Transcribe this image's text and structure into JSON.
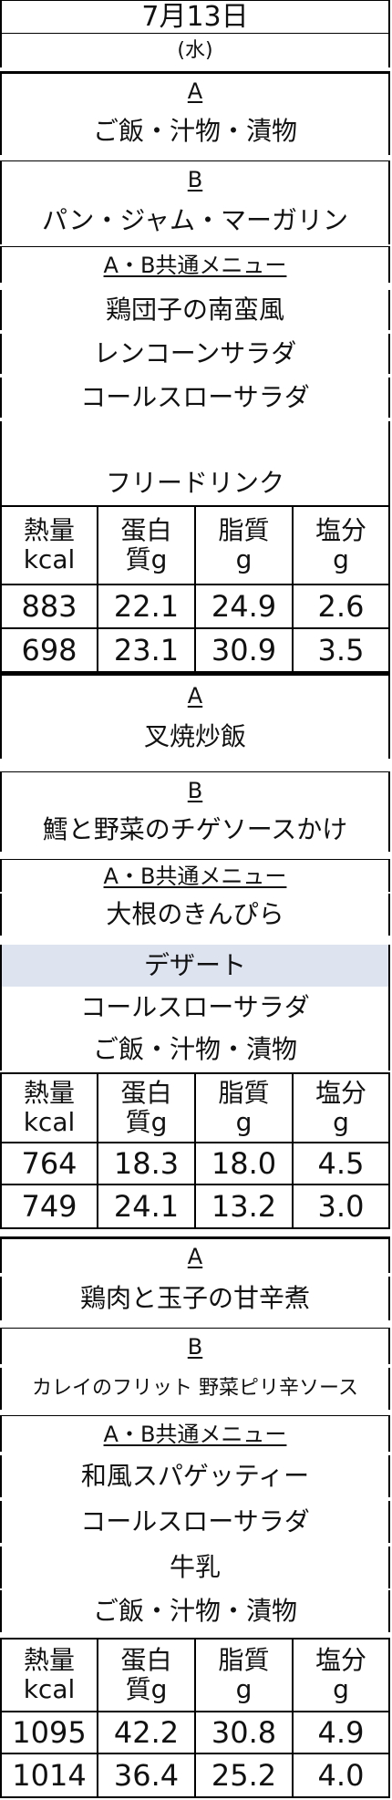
{
  "header": {
    "date": "7月13日",
    "weekday": "(水)"
  },
  "days": [
    {
      "a_label": "A",
      "a_items": [
        "ご飯・汁物・漬物"
      ],
      "b_label": "B",
      "b_items": [
        "パン・ジャム・マーガリン"
      ],
      "common_label": "A・B共通メニュー",
      "common_items": [
        "鶏団子の南蛮風",
        "レンコーンサラダ",
        "コールスローサラダ",
        "",
        "フリードリンク"
      ],
      "nutrition_header": [
        "熱量 kcal",
        "蛋白 質g",
        "脂質 g",
        "塩分 g"
      ],
      "nutrition_rows": [
        [
          "883",
          "22.1",
          "24.9",
          "2.6"
        ],
        [
          "698",
          "23.1",
          "30.9",
          "3.5"
        ]
      ]
    },
    {
      "a_label": "A",
      "a_items": [
        "叉焼炒飯"
      ],
      "b_label": "B",
      "b_items": [
        "鱈と野菜のチゲソースかけ"
      ],
      "common_label": "A・B共通メニュー",
      "common_items": [
        "大根のきんぴら",
        "デザート",
        "コールスローサラダ",
        "ご飯・汁物・漬物"
      ],
      "nutrition_header": [
        "熱量 kcal",
        "蛋白 質g",
        "脂質 g",
        "塩分 g"
      ],
      "nutrition_rows": [
        [
          "764",
          "18.3",
          "18.0",
          "4.5"
        ],
        [
          "749",
          "24.1",
          "13.2",
          "3.0"
        ]
      ]
    },
    {
      "a_label": "A",
      "a_items": [
        "鶏肉と玉子の甘辛煮"
      ],
      "b_label": "B",
      "b_items": [
        "カレイのフリット 野菜ピリ辛ソース"
      ],
      "common_label": "A・B共通メニュー",
      "common_items": [
        "和風スパゲッティー",
        "コールスローサラダ",
        "牛乳",
        "ご飯・汁物・漬物"
      ],
      "nutrition_header": [
        "熱量 kcal",
        "蛋白 質g",
        "脂質 g",
        "塩分 g"
      ],
      "nutrition_rows": [
        [
          "1095",
          "42.2",
          "30.8",
          "4.9"
        ],
        [
          "1014",
          "36.4",
          "25.2",
          "4.0"
        ]
      ]
    }
  ],
  "colors": {
    "highlight": "#dde3ef",
    "border": "#000000"
  }
}
